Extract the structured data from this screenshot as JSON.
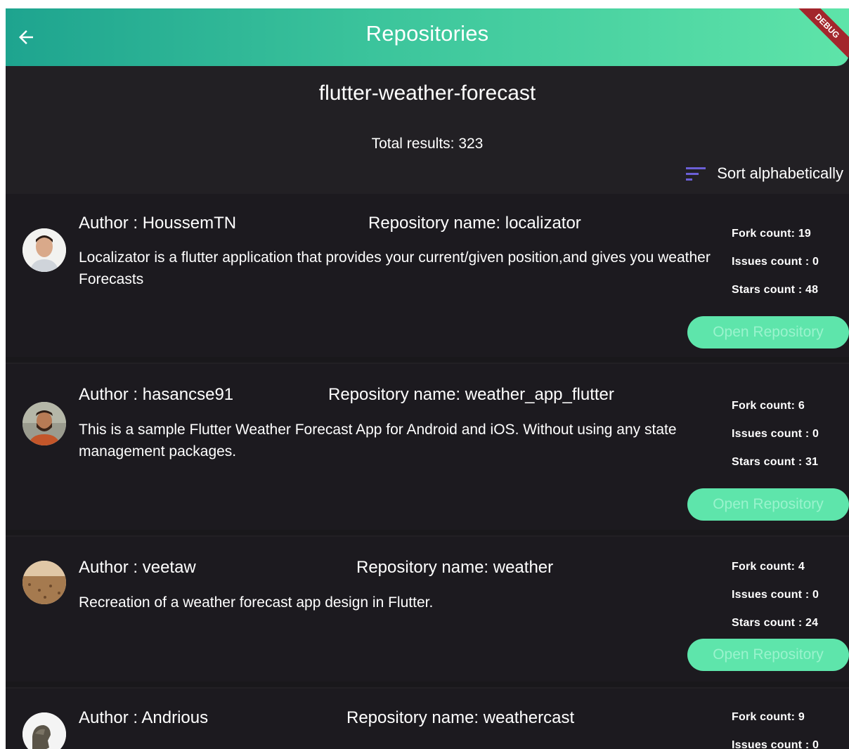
{
  "appbar": {
    "title": "Repositories",
    "back_icon": "arrow-left-icon",
    "debug_badge": "DEBUG"
  },
  "header": {
    "search_term": "flutter-weather-forecast",
    "total_results": "Total results: 323",
    "sort_label": "Sort alphabetically",
    "sort_icon": "sort-icon"
  },
  "repositories": [
    {
      "author": "Author : HoussemTN",
      "repo_name": "Repository name: localizator",
      "description": "Localizator is a flutter application that provides your current/given position,and gives you weather Forecasts",
      "fork_count": "Fork count: 19",
      "issues_count": "Issues count : 0",
      "stars_count": "Stars count : 48",
      "open_label": "Open Repository"
    },
    {
      "author": "Author : hasancse91",
      "repo_name": "Repository name: weather_app_flutter",
      "description": "This is a sample Flutter Weather Forecast App for Android and iOS. Without using any state management packages.",
      "fork_count": "Fork count: 6",
      "issues_count": "Issues count : 0",
      "stars_count": "Stars count : 31",
      "open_label": "Open Repository"
    },
    {
      "author": "Author : veetaw",
      "repo_name": "Repository name: weather",
      "description": "Recreation of a weather forecast app design in Flutter.",
      "fork_count": "Fork count: 4",
      "issues_count": "Issues count : 0",
      "stars_count": "Stars count : 24",
      "open_label": "Open Repository"
    },
    {
      "author": "Author : Andrious",
      "repo_name": "Repository name: weathercast",
      "fork_count": "Fork count: 9",
      "issues_count": "Issues count : 0"
    }
  ],
  "colors": {
    "appbar_start": "#1ea48f",
    "appbar_end": "#5ee4a9",
    "background": "#222024",
    "card": "#1c1a1f",
    "button": "#5ee5ab",
    "button_text": "#9af3cd",
    "sort_icon": "#6b5fd6"
  }
}
